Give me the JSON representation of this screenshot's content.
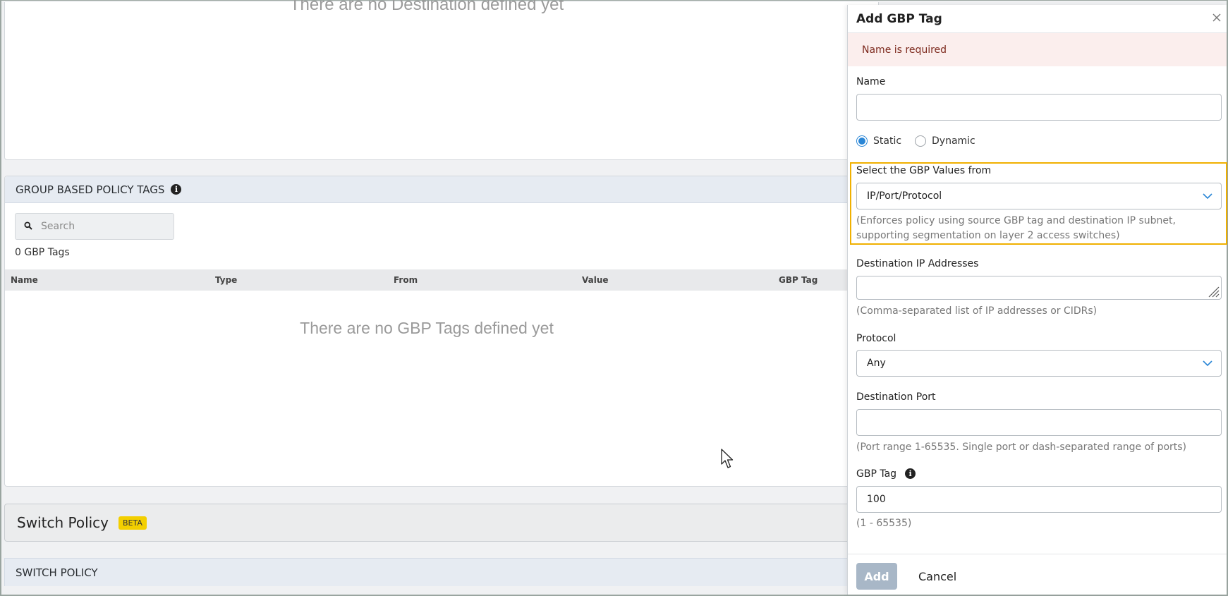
{
  "background_page": {
    "top_empty_message": "There are no Destination defined yet",
    "gbp_section": {
      "title": "GROUP BASED POLICY TAGS",
      "info_icon": "info-circle",
      "search_placeholder": "Search",
      "count_label": "0 GBP Tags",
      "columns": [
        "Name",
        "Type",
        "From",
        "Value",
        "GBP Tag"
      ],
      "empty_message": "There are no GBP Tags defined yet"
    },
    "switch_policy_card": {
      "title": "Switch Policy",
      "badge": "BETA"
    },
    "switch_policy_header": "SWITCH POLICY"
  },
  "panel": {
    "title": "Add GBP Tag",
    "close_icon": "close-x",
    "alert": "Name is required",
    "name_label": "Name",
    "name_value": "",
    "type_options": [
      {
        "label": "Static",
        "selected": true
      },
      {
        "label": "Dynamic",
        "selected": false
      }
    ],
    "gbp_values_label": "Select the GBP Values from",
    "gbp_values_selected": "IP/Port/Protocol",
    "gbp_values_hint": "(Enforces policy using source GBP tag and destination IP subnet, supporting segmentation on layer 2 access switches)",
    "dest_ip_label": "Destination IP Addresses",
    "dest_ip_value": "",
    "dest_ip_hint": "(Comma-separated list of IP addresses or CIDRs)",
    "protocol_label": "Protocol",
    "protocol_selected": "Any",
    "dest_port_label": "Destination Port",
    "dest_port_value": "",
    "dest_port_hint": "(Port range 1-65535. Single port or dash-separated range of ports)",
    "gbp_tag_label": "GBP Tag",
    "gbp_tag_value": "100",
    "gbp_tag_hint": "(1 - 65535)",
    "add_button": "Add",
    "cancel_button": "Cancel"
  },
  "colors": {
    "highlight_border": "#f0b000",
    "alert_bg": "#fbeeed",
    "alert_text": "#7d2a1e",
    "radio_accent": "#2a86d6",
    "chevron": "#2a86d6",
    "add_button_disabled": "#a8b7c7",
    "section_header_bg": "#e6ebf2",
    "beta_badge": "#f3cf00"
  }
}
